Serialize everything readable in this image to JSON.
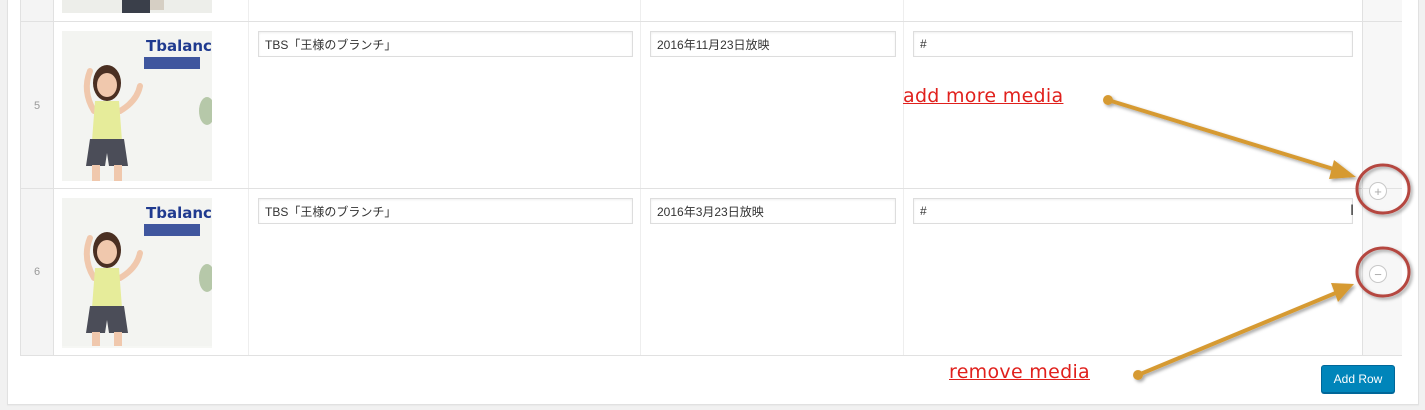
{
  "repeater": {
    "rows": [
      {
        "number": "5",
        "title_value": "TBS「王様のブランチ」",
        "date_value": "2016年11月23日放映",
        "link_value": "#",
        "thumbnail_logo": "Tbalance"
      },
      {
        "number": "6",
        "title_value": "TBS「王様のブランチ」",
        "date_value": "2016年3月23日放映",
        "link_value": "#",
        "thumbnail_logo": "Tbalance"
      }
    ],
    "add_row_label": "Add Row",
    "add_icon": "plus-icon",
    "remove_icon": "minus-icon"
  },
  "annotations": {
    "add_more": "add more media",
    "remove": "remove media",
    "arrow_color": "#d69a33",
    "circle_color": "#b5463f",
    "text_color": "#e0201c"
  },
  "colors": {
    "primary_button": "#0085ba"
  }
}
